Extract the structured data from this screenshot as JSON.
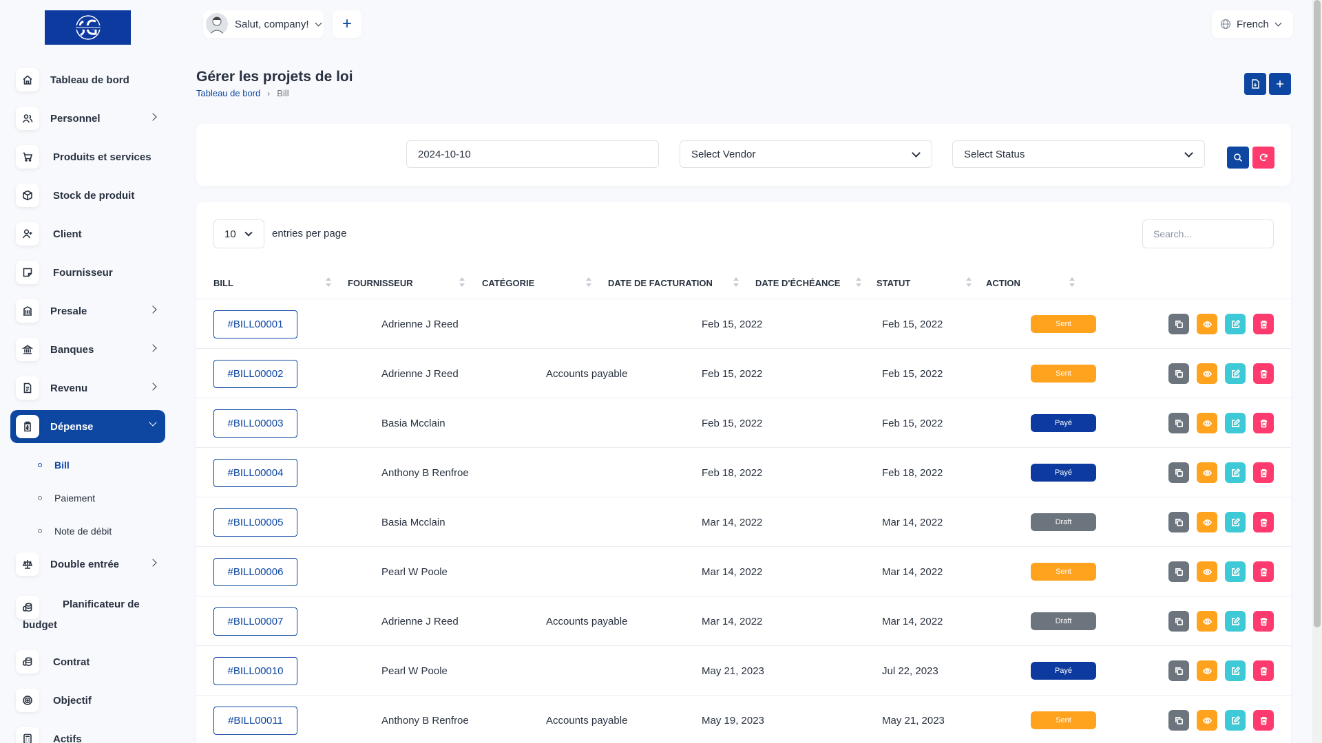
{
  "header": {
    "greeting": "Salut, company!",
    "language": "French"
  },
  "sidebar": {
    "items": [
      {
        "label": "Tableau de bord",
        "icon": "home-icon",
        "chevron": false
      },
      {
        "label": "Personnel",
        "icon": "users-icon",
        "chevron": true
      },
      {
        "label": "Produits et services",
        "icon": "cart-icon",
        "chevron": false
      },
      {
        "label": "Stock de produit",
        "icon": "box-icon",
        "chevron": false
      },
      {
        "label": "Client",
        "icon": "user-plus-icon",
        "chevron": false
      },
      {
        "label": "Fournisseur",
        "icon": "note-icon",
        "chevron": false
      },
      {
        "label": "Presale",
        "icon": "building-icon",
        "chevron": true
      },
      {
        "label": "Banques",
        "icon": "bank-icon",
        "chevron": true
      },
      {
        "label": "Revenu",
        "icon": "file-icon",
        "chevron": true
      },
      {
        "label": "Dépense",
        "icon": "clipboard-icon",
        "chevron": true,
        "active": true
      }
    ],
    "sub_items": [
      {
        "label": "Bill",
        "active": true
      },
      {
        "label": "Paiement"
      },
      {
        "label": "Note de débit"
      }
    ],
    "items_after": [
      {
        "label": "Double entrée",
        "icon": "scale-icon",
        "chevron": true
      },
      {
        "label": "Planificateur de",
        "label2": "budget",
        "icon": "coins-icon"
      },
      {
        "label": "Contrat",
        "icon": "coins-icon"
      },
      {
        "label": "Objectif",
        "icon": "target-icon"
      },
      {
        "label": "Actifs",
        "icon": "calculator-icon"
      }
    ]
  },
  "page": {
    "title": "Gérer les projets de loi",
    "breadcrumb": {
      "home": "Tableau de bord",
      "current": "Bill"
    }
  },
  "filters": {
    "date": "2024-10-10",
    "vendor": "Select Vendor",
    "status": "Select Status"
  },
  "table": {
    "per_page": "10",
    "per_page_label": "entries per page",
    "search_placeholder": "Search...",
    "columns": [
      "BILL",
      "FOURNISSEUR",
      "CATÉGORIE",
      "DATE DE FACTURATION",
      "DATE D'ÉCHÉANCE",
      "STATUT",
      "ACTION"
    ],
    "rows": [
      {
        "bill": "#BILL00001",
        "vendor": "Adrienne J Reed",
        "category": "",
        "bill_date": "Feb 15, 2022",
        "due_date": "Feb 15, 2022",
        "status": "Sent",
        "status_kind": "sent"
      },
      {
        "bill": "#BILL00002",
        "vendor": "Adrienne J Reed",
        "category": "Accounts payable",
        "bill_date": "Feb 15, 2022",
        "due_date": "Feb 15, 2022",
        "status": "Sent",
        "status_kind": "sent"
      },
      {
        "bill": "#BILL00003",
        "vendor": "Basia Mcclain",
        "category": "",
        "bill_date": "Feb 15, 2022",
        "due_date": "Feb 15, 2022",
        "status": "Payé",
        "status_kind": "paid"
      },
      {
        "bill": "#BILL00004",
        "vendor": "Anthony B Renfroe",
        "category": "",
        "bill_date": "Feb 18, 2022",
        "due_date": "Feb 18, 2022",
        "status": "Payé",
        "status_kind": "paid"
      },
      {
        "bill": "#BILL00005",
        "vendor": "Basia Mcclain",
        "category": "",
        "bill_date": "Mar 14, 2022",
        "due_date": "Mar 14, 2022",
        "status": "Draft",
        "status_kind": "draft"
      },
      {
        "bill": "#BILL00006",
        "vendor": "Pearl W Poole",
        "category": "",
        "bill_date": "Mar 14, 2022",
        "due_date": "Mar 14, 2022",
        "status": "Sent",
        "status_kind": "sent"
      },
      {
        "bill": "#BILL00007",
        "vendor": "Adrienne J Reed",
        "category": "Accounts payable",
        "bill_date": "Mar 14, 2022",
        "due_date": "Mar 14, 2022",
        "status": "Draft",
        "status_kind": "draft"
      },
      {
        "bill": "#BILL00010",
        "vendor": "Pearl W Poole",
        "category": "",
        "bill_date": "May 21, 2023",
        "due_date": "Jul 22, 2023",
        "status": "Payé",
        "status_kind": "paid"
      },
      {
        "bill": "#BILL00011",
        "vendor": "Anthony B Renfroe",
        "category": "Accounts payable",
        "bill_date": "May 19, 2023",
        "due_date": "May 21, 2023",
        "status": "Sent",
        "status_kind": "sent"
      }
    ]
  },
  "colors": {
    "primary": "#0d47a1",
    "sent": "#ffa21d",
    "paid": "#0d3a9e",
    "draft": "#6c757d",
    "danger": "#ff3a6e",
    "info": "#3ec9d6"
  }
}
